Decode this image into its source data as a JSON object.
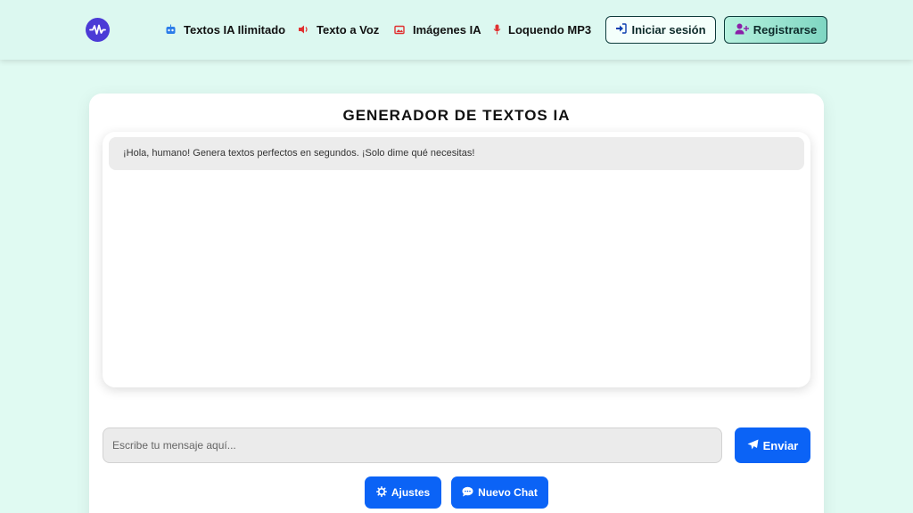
{
  "header": {
    "logo_icon": "waveform-logo-icon",
    "nav": [
      {
        "label": "Textos IA Ilimitado",
        "icon": "robot-icon",
        "color": "#2b7de9"
      },
      {
        "label": "Texto a Voz",
        "icon": "speaker-icon",
        "color": "#e03131"
      },
      {
        "label": "Imágenes IA",
        "icon": "image-icon",
        "color": "#e03131"
      },
      {
        "label": "Loquendo MP3",
        "icon": "microphone-icon",
        "color": "#e03131"
      }
    ],
    "login_label": "Iniciar sesión",
    "register_label": "Registrarse"
  },
  "main": {
    "title": "GENERADOR DE TEXTOS IA",
    "messages": [
      {
        "role": "bot",
        "text": "¡Hola, humano! Genera textos perfectos en segundos. ¡Solo dime qué necesitas!"
      }
    ],
    "input_placeholder": "Escribe tu mensaje aquí...",
    "input_value": "",
    "send_label": "Enviar",
    "settings_label": "Ajustes",
    "new_chat_label": "Nuevo Chat"
  },
  "colors": {
    "background": "#e0faf2",
    "accent_blue": "#0b63f6",
    "logo_purple": "#4b3bd6"
  }
}
